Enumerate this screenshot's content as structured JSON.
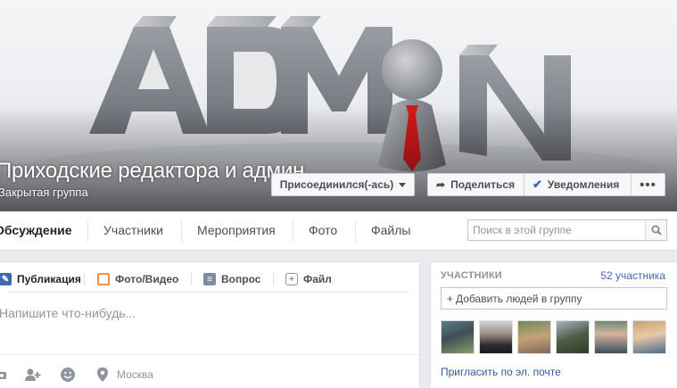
{
  "group": {
    "title": "Приходские редактора и админ",
    "type": "Закрытая группа",
    "cover_art": "ADMIN 3D letters with pawn in red tie"
  },
  "header_buttons": {
    "joined": "Присоединился(-ась)",
    "share": "Поделиться",
    "notifications": "Уведомления",
    "more": "•••"
  },
  "tabs": [
    "Обсуждение",
    "Участники",
    "Мероприятия",
    "Фото",
    "Файлы"
  ],
  "search": {
    "placeholder": "Поиск в этой группе"
  },
  "composer": {
    "tabs": [
      "Публикация",
      "Фото/Видео",
      "Вопрос",
      "Файл"
    ],
    "placeholder": "Напишите что-нибудь...",
    "location": "Москва"
  },
  "members": {
    "title": "УЧАСТНИКИ",
    "count": "52 участника",
    "add_placeholder": "Добавить людей в группу",
    "invite": "Пригласить по эл. почте"
  },
  "colors": {
    "link": "#4267b2",
    "accent_red": "#d11a1a"
  }
}
